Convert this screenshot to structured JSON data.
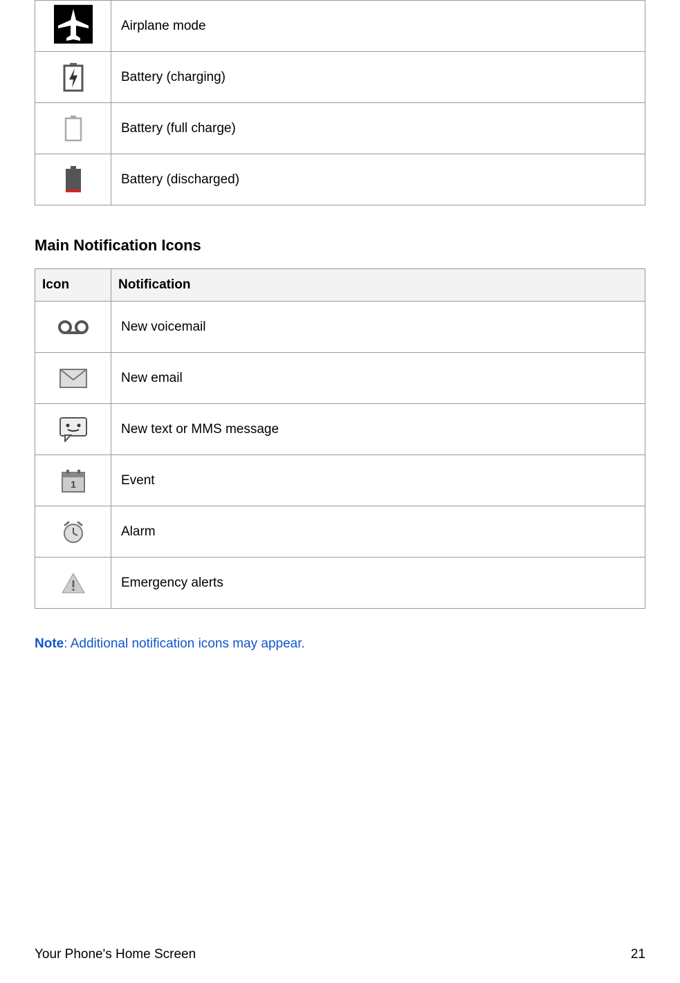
{
  "status_table": {
    "rows": [
      {
        "icon": "airplane-mode-icon",
        "label": "Airplane mode"
      },
      {
        "icon": "battery-charging-icon",
        "label": "Battery (charging)"
      },
      {
        "icon": "battery-full-icon",
        "label": "Battery (full charge)"
      },
      {
        "icon": "battery-discharged-icon",
        "label": "Battery (discharged)"
      }
    ]
  },
  "notification_section": {
    "title": "Main Notification Icons",
    "header_icon": "Icon",
    "header_notification": "Notification",
    "rows": [
      {
        "icon": "voicemail-icon",
        "label": "New voicemail"
      },
      {
        "icon": "email-icon",
        "label": "New email"
      },
      {
        "icon": "sms-icon",
        "label": "New text or MMS message"
      },
      {
        "icon": "event-icon",
        "label": "Event"
      },
      {
        "icon": "alarm-icon",
        "label": "Alarm"
      },
      {
        "icon": "emergency-alert-icon",
        "label": "Emergency alerts"
      }
    ]
  },
  "note": {
    "label": "Note",
    "text": ": Additional notification icons may appear."
  },
  "footer": {
    "left": "Your Phone's Home Screen",
    "right": "21"
  }
}
